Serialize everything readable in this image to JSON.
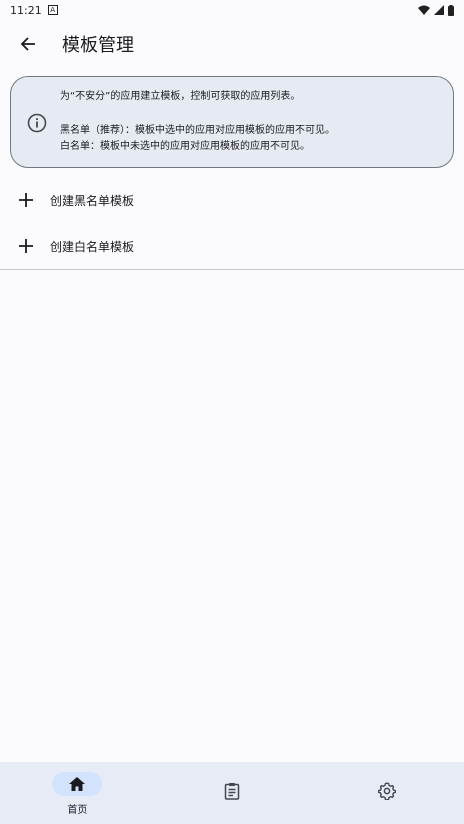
{
  "status_bar": {
    "time": "11:21",
    "indicator": "A"
  },
  "app_bar": {
    "title": "模板管理",
    "back_icon": "arrow-left-icon"
  },
  "info_card": {
    "icon": "info-icon",
    "line1": "为“不安分”的应用建立模板，控制可获取的应用列表。",
    "line2": "黑名单（推荐）：模板中选中的应用对应用模板的应用不可见。",
    "line3": "白名单：模板中未选中的应用对应用模板的应用不可见。"
  },
  "actions": [
    {
      "label": "创建黑名单模板",
      "icon": "plus-icon"
    },
    {
      "label": "创建白名单模板",
      "icon": "plus-icon"
    }
  ],
  "bottom_nav": {
    "items": [
      {
        "label": "首页",
        "icon": "home-icon",
        "active": true
      },
      {
        "label": "",
        "icon": "clipboard-icon",
        "active": false
      },
      {
        "label": "",
        "icon": "gear-icon",
        "active": false
      }
    ]
  },
  "colors": {
    "card_bg": "#e6ebf3",
    "nav_bg": "#e6ebf6",
    "active_pill": "#d3e3fd",
    "text": "#1b1b1f"
  }
}
